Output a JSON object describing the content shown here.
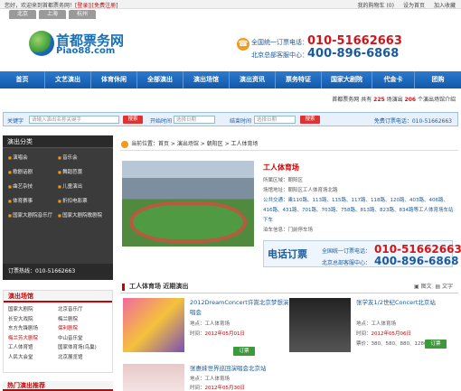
{
  "topbar": {
    "greeting_prefix": "您好，欢迎来到首都票务网！",
    "login": "[登录]",
    "register": "[免费注册]",
    "links": [
      "我的购物车 (0)",
      "设为首页",
      "加入收藏"
    ]
  },
  "city_tabs": [
    "北京",
    "上海",
    "杭州"
  ],
  "logo": {
    "cn": "首都票务网",
    "en": "Piao88.com"
  },
  "hotline": {
    "label1": "全国统一订票电话：",
    "number1": "010-51662663",
    "label2": "北京总部客服中心：",
    "number2": "400-896-6868"
  },
  "nav": [
    "首页",
    "文艺演出",
    "体育休闲",
    "全部演出",
    "演出场馆",
    "演出资讯",
    "票务特证",
    "国家大剧院",
    "代金卡",
    "团购"
  ],
  "stats": {
    "prefix": "首都票务网 共有",
    "shows": "225",
    "mid": "场演出",
    "venues": "206",
    "suffix": "个演出场馆介绍"
  },
  "search": {
    "keyword_label": "关键字",
    "keyword_placeholder": "请输入演出名称关键字",
    "btn": "搜索",
    "start_label": "开始时间",
    "start_placeholder": "选择日期",
    "end_label": "结束时间",
    "end_placeholder": "选择日期",
    "btn2": "搜索",
    "site": "免费订票电话：010-51662663"
  },
  "categories": {
    "title": "演出分类",
    "items": [
      "演唱会",
      "音乐会",
      "歌剧话剧",
      "舞蹈芭蕾",
      "曲艺杂技",
      "儿童演出",
      "体育赛事",
      "折扣电影票",
      "国家大剧院音乐厅",
      "国家大剧院歌剧院"
    ],
    "hotline": "订票热线：010-51662663"
  },
  "venues": {
    "title": "演出场馆",
    "items": [
      "国家大剧院",
      "北京音乐厅",
      "长安大戏院",
      "梅兰剧院",
      "东方先锋剧场",
      "保利剧院",
      "梅兰芳大剧院",
      "中山音乐堂",
      "工人体育馆",
      "国家体育场(鸟巢)",
      "人民大会堂",
      "北京展览馆"
    ]
  },
  "hot_rec": "热门演出推荐",
  "crumb": "当前位置：首页 > 演出场馆 > 朝阳区 > 工人体育场",
  "venue": {
    "name": "工人体育场",
    "district": "所属区域：朝阳区",
    "address": "场馆地址：朝阳区工人体育场北路",
    "bus": "公共交通：乘110路、113路、115路、117路、118路、120路、403路、406路、416路、431路、701路、703路、758路、813路、823路、834路等工人体育场车站下车",
    "parking": "泊车信息：门前停车场"
  },
  "callbox": {
    "title": "电话订票",
    "label1": "全国统一订票电话：",
    "number1": "010-51662663",
    "label2": "北京总部客服中心：",
    "number2": "400-896-6868"
  },
  "recent": {
    "title": "工人体育场 近期演出",
    "view1": "图文",
    "view2": "文字",
    "shows": [
      {
        "title": "2012DreamConcert许嵩北京梦想演唱会",
        "place": "地点：工人体育场",
        "time_label": "时间：",
        "time": "2012年05月01日",
        "order": "订票"
      },
      {
        "title": "张学友1/2世纪Concert北京站",
        "place": "地点：工人体育场",
        "time_label": "时间：",
        "time": "2012年05月06日",
        "price": "票价：380、580、880、1280...",
        "order": "订票"
      },
      {
        "title": "张惠妹世界巡回演唱会北京站",
        "place": "地点：工人体育场",
        "time_label": "时间：",
        "time": "2012年05月30日"
      }
    ]
  }
}
